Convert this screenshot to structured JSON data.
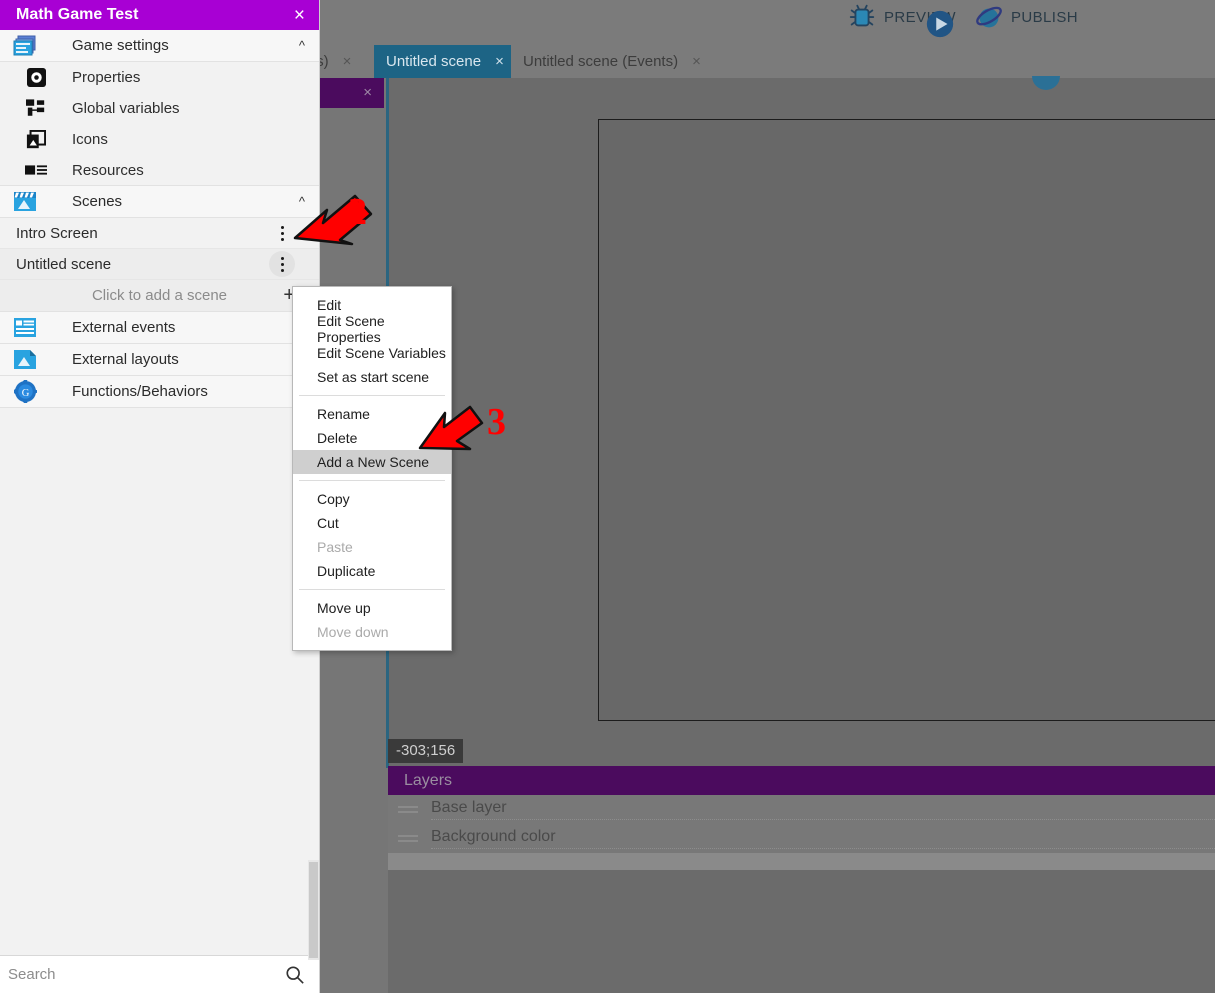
{
  "toolbar": {
    "debug_icon": "bug-icon",
    "preview_label": "PREVIEW",
    "publish_label": "PUBLISH"
  },
  "tabs": [
    {
      "label": "ts)",
      "close": "×",
      "active": false
    },
    {
      "label": "Untitled scene",
      "close": "×",
      "active": true
    },
    {
      "label": "Untitled scene (Events)",
      "close": "×",
      "active": false
    }
  ],
  "canvas": {
    "coordinates": "-303;156"
  },
  "layers_panel": {
    "title": "Layers",
    "layers": [
      {
        "name": "Base layer"
      },
      {
        "name": "Background color"
      }
    ]
  },
  "ghost_panel": {
    "close": "×"
  },
  "sidebar": {
    "project_title": "Math Game Test",
    "close": "×",
    "game_settings": {
      "label": "Game settings",
      "icon": "game-settings-icon",
      "chevron": "⌃",
      "items": [
        {
          "label": "Properties",
          "icon": "properties-gear-icon"
        },
        {
          "label": "Global variables",
          "icon": "global-variables-icon"
        },
        {
          "label": "Icons",
          "icon": "icons-image-icon"
        },
        {
          "label": "Resources",
          "icon": "resources-list-icon"
        }
      ]
    },
    "scenes": {
      "label": "Scenes",
      "icon": "scenes-clapperboard-icon",
      "chevron": "⌃",
      "items": [
        {
          "label": "Intro Screen",
          "menu_icon": "more-vertical-icon"
        },
        {
          "label": "Untitled scene",
          "menu_icon": "more-vertical-icon"
        }
      ],
      "add_label": "Click to add a scene",
      "add_plus": "+"
    },
    "sections": [
      {
        "label": "External events",
        "icon": "external-events-icon",
        "chevron": "⌄"
      },
      {
        "label": "External layouts",
        "icon": "external-layouts-icon",
        "chevron": "⌄"
      },
      {
        "label": "Functions/Behaviors",
        "icon": "functions-behaviors-icon",
        "chevron": "⌄"
      }
    ],
    "search": {
      "value": "",
      "placeholder": "Search",
      "icon": "search-icon"
    }
  },
  "context_menu": {
    "groups": [
      [
        {
          "label": "Edit",
          "state": "normal"
        },
        {
          "label": "Edit Scene Properties",
          "state": "normal"
        },
        {
          "label": "Edit Scene Variables",
          "state": "normal"
        },
        {
          "label": "Set as start scene",
          "state": "normal"
        }
      ],
      [
        {
          "label": "Rename",
          "state": "normal"
        },
        {
          "label": "Delete",
          "state": "normal"
        },
        {
          "label": "Add a New Scene",
          "state": "selected"
        }
      ],
      [
        {
          "label": "Copy",
          "state": "normal"
        },
        {
          "label": "Cut",
          "state": "normal"
        },
        {
          "label": "Paste",
          "state": "disabled"
        },
        {
          "label": "Duplicate",
          "state": "normal"
        }
      ],
      [
        {
          "label": "Move up",
          "state": "normal"
        },
        {
          "label": "Move down",
          "state": "disabled"
        }
      ]
    ]
  },
  "annotations": [
    {
      "number": "2",
      "color": "#ff0000"
    },
    {
      "number": "3",
      "color": "#ff0000"
    }
  ]
}
